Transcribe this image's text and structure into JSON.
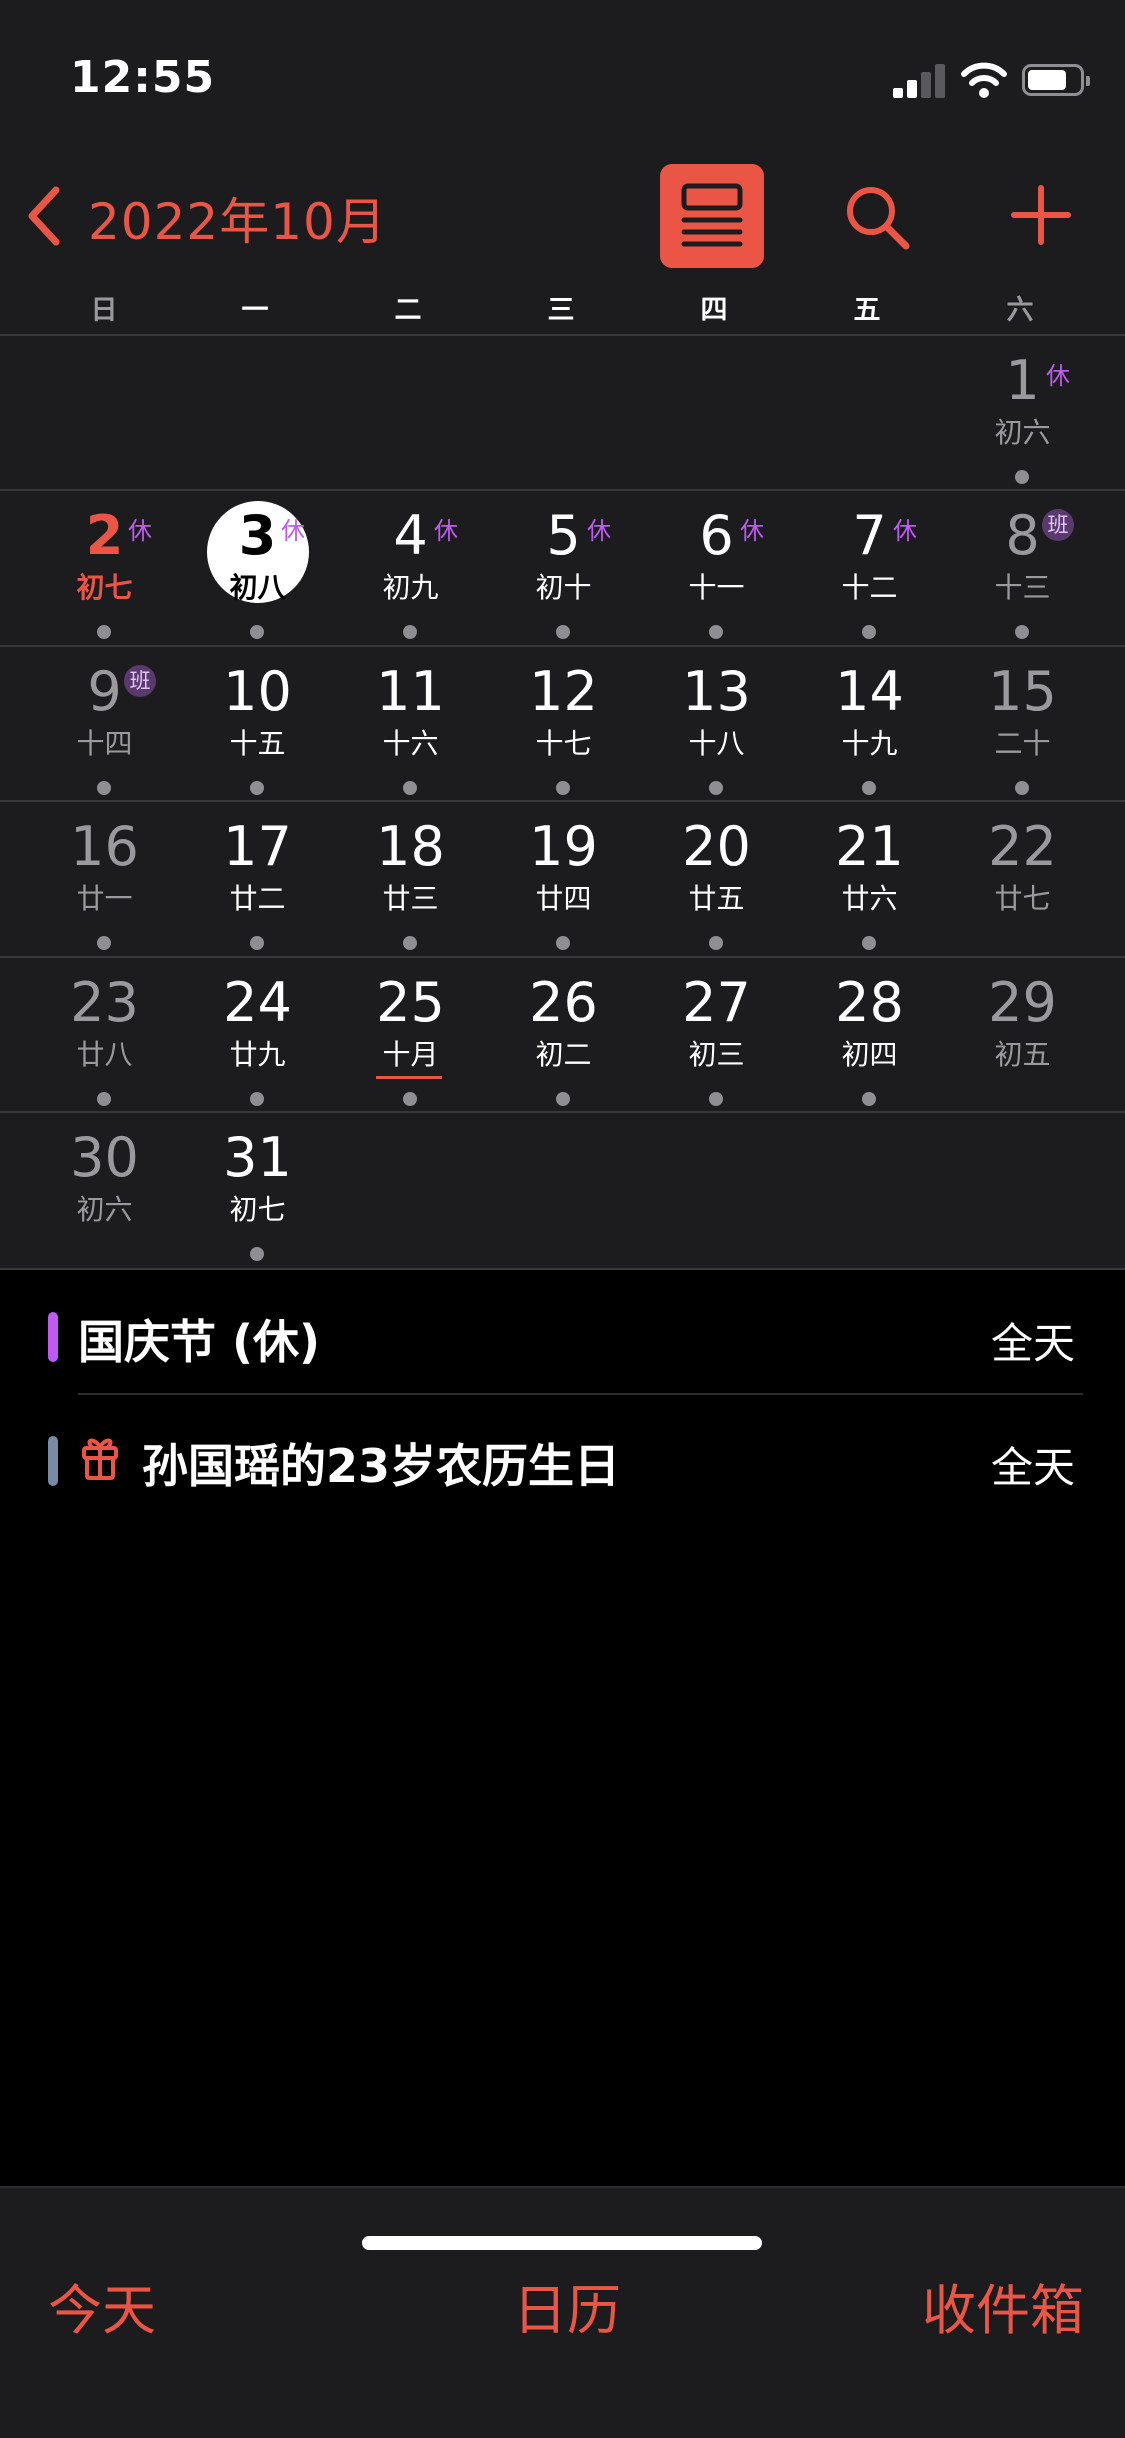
{
  "status_bar": {
    "time": "12:55"
  },
  "nav": {
    "title": "2022年10月",
    "icons": [
      "chevron-left-icon",
      "list-view-icon",
      "search-icon",
      "plus-icon"
    ]
  },
  "weekdays": [
    "日",
    "一",
    "二",
    "三",
    "四",
    "五",
    "六"
  ],
  "calendar": {
    "weeks": [
      [
        null,
        null,
        null,
        null,
        null,
        null,
        {
          "day": "1",
          "lunar": "初六",
          "badge": "休",
          "dot": true
        }
      ],
      [
        {
          "day": "2",
          "lunar": "初七",
          "badge": "休",
          "dot": true
        },
        {
          "day": "3",
          "lunar": "初八",
          "badge": "休",
          "dot": true,
          "today": true
        },
        {
          "day": "4",
          "lunar": "初九",
          "badge": "休",
          "dot": true
        },
        {
          "day": "5",
          "lunar": "初十",
          "badge": "休",
          "dot": true
        },
        {
          "day": "6",
          "lunar": "十一",
          "badge": "休",
          "dot": true
        },
        {
          "day": "7",
          "lunar": "十二",
          "badge": "休",
          "dot": true
        },
        {
          "day": "8",
          "lunar": "十三",
          "badge": "班",
          "dot": true
        }
      ],
      [
        {
          "day": "9",
          "lunar": "十四",
          "badge": "班",
          "dot": true
        },
        {
          "day": "10",
          "lunar": "十五",
          "dot": true
        },
        {
          "day": "11",
          "lunar": "十六",
          "dot": true
        },
        {
          "day": "12",
          "lunar": "十七",
          "dot": true
        },
        {
          "day": "13",
          "lunar": "十八",
          "dot": true
        },
        {
          "day": "14",
          "lunar": "十九",
          "dot": true
        },
        {
          "day": "15",
          "lunar": "二十",
          "dot": true
        }
      ],
      [
        {
          "day": "16",
          "lunar": "廿一",
          "dot": true
        },
        {
          "day": "17",
          "lunar": "廿二",
          "dot": true
        },
        {
          "day": "18",
          "lunar": "廿三",
          "dot": true
        },
        {
          "day": "19",
          "lunar": "廿四",
          "dot": true
        },
        {
          "day": "20",
          "lunar": "廿五",
          "dot": true
        },
        {
          "day": "21",
          "lunar": "廿六",
          "dot": true
        },
        {
          "day": "22",
          "lunar": "廿七",
          "dot": false
        }
      ],
      [
        {
          "day": "23",
          "lunar": "廿八",
          "dot": true
        },
        {
          "day": "24",
          "lunar": "廿九",
          "dot": true
        },
        {
          "day": "25",
          "lunar": "十月",
          "dot": true,
          "underline": true
        },
        {
          "day": "26",
          "lunar": "初二",
          "dot": true
        },
        {
          "day": "27",
          "lunar": "初三",
          "dot": true
        },
        {
          "day": "28",
          "lunar": "初四",
          "dot": true
        },
        {
          "day": "29",
          "lunar": "初五",
          "dot": false
        }
      ],
      [
        {
          "day": "30",
          "lunar": "初六",
          "dot": false
        },
        {
          "day": "31",
          "lunar": "初七",
          "dot": true
        },
        null,
        null,
        null,
        null,
        null
      ]
    ]
  },
  "events": [
    {
      "title": "国庆节 (休)",
      "time": "全天",
      "color": "#bf5af2",
      "icon": ""
    },
    {
      "title": "孙国瑶的23岁农历生日",
      "time": "全天",
      "color": "#7a8aa6",
      "icon": "gift-icon"
    }
  ],
  "tabbar": {
    "today": "今天",
    "calendars": "日历",
    "inbox": "收件箱"
  },
  "colors": {
    "accent": "#eb5545",
    "holiday": "#bf5af2",
    "muted": "#9a9a9e"
  }
}
